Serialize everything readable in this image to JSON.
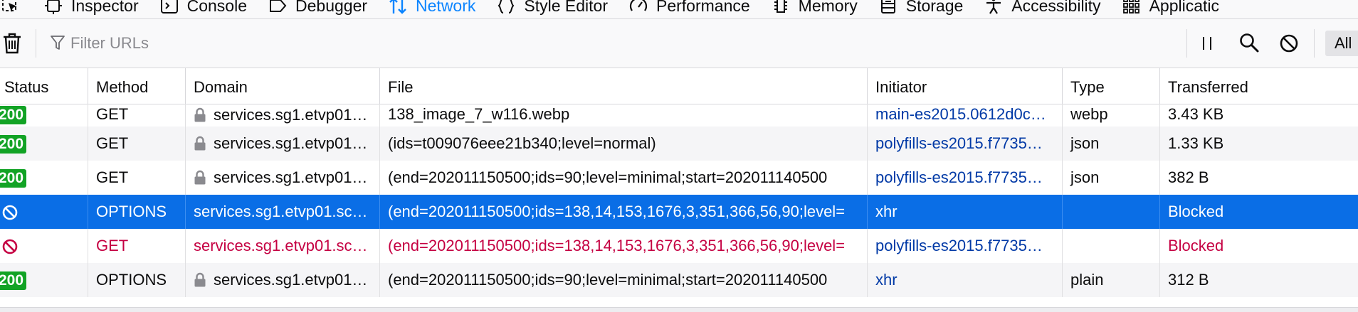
{
  "tabs": [
    {
      "label": "",
      "icon": "cursor-pick-icon"
    },
    {
      "label": "Inspector",
      "icon": "inspector-icon"
    },
    {
      "label": "Console",
      "icon": "console-icon"
    },
    {
      "label": "Debugger",
      "icon": "debugger-icon"
    },
    {
      "label": "Network",
      "icon": "network-icon",
      "active": true
    },
    {
      "label": "Style Editor",
      "icon": "style-editor-icon"
    },
    {
      "label": "Performance",
      "icon": "performance-icon"
    },
    {
      "label": "Memory",
      "icon": "memory-icon"
    },
    {
      "label": "Storage",
      "icon": "storage-icon"
    },
    {
      "label": "Accessibility",
      "icon": "accessibility-icon"
    },
    {
      "label": "Applicatic",
      "icon": "application-icon"
    }
  ],
  "filter": {
    "placeholder": "Filter URLs",
    "all_label": "All"
  },
  "table": {
    "columns": [
      "Status",
      "Method",
      "Domain",
      "File",
      "Initiator",
      "Type",
      "Transferred"
    ],
    "rows": [
      {
        "status": "200",
        "method": "GET",
        "secure": true,
        "domain": "services.sg1.etvp01…",
        "file": "138_image_7_w116.webp",
        "initiator": "main-es2015.0612d0c…",
        "type": "webp",
        "transferred": "3.43 KB"
      },
      {
        "status": "200",
        "method": "GET",
        "secure": true,
        "domain": "services.sg1.etvp01…",
        "file": "(ids=t009076eee21b340;level=normal)",
        "initiator": "polyfills-es2015.f7735…",
        "type": "json",
        "transferred": "1.33 KB"
      },
      {
        "status": "200",
        "method": "GET",
        "secure": true,
        "domain": "services.sg1.etvp01…",
        "file": "(end=202011150500;ids=90;level=minimal;start=202011140500",
        "initiator": "polyfills-es2015.f7735…",
        "type": "json",
        "transferred": "382 B"
      },
      {
        "status": "blocked",
        "method": "OPTIONS",
        "secure": false,
        "domain": "services.sg1.etvp01.sc…",
        "file": "(end=202011150500;ids=138,14,153,1676,3,351,366,56,90;level=",
        "initiator": "xhr",
        "type": "",
        "transferred": "Blocked",
        "selected": true
      },
      {
        "status": "blocked",
        "method": "GET",
        "secure": false,
        "domain": "services.sg1.etvp01.sc…",
        "file": "(end=202011150500;ids=138,14,153,1676,3,351,366,56,90;level=",
        "initiator": "polyfills-es2015.f7735…",
        "type": "",
        "transferred": "Blocked",
        "blocked": true
      },
      {
        "status": "200",
        "method": "OPTIONS",
        "secure": true,
        "domain": "services.sg1.etvp01…",
        "file": "(end=202011150500;ids=90;level=minimal;start=202011140500",
        "initiator": "xhr",
        "type": "plain",
        "transferred": "312 B"
      }
    ]
  },
  "colors": {
    "accent": "#0a84ff",
    "selected_row": "#0a6ee6",
    "status_ok": "#12a325",
    "blocked": "#c50042",
    "initiator_link": "#0039a6"
  }
}
